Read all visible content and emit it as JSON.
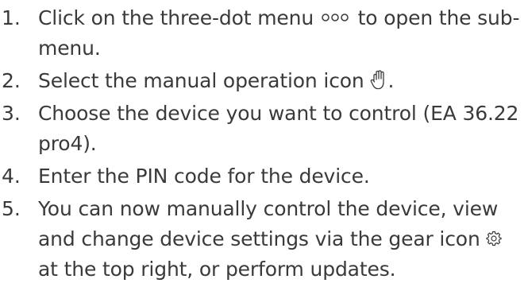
{
  "steps": [
    {
      "number": "1.",
      "before": "Click on the three-dot menu",
      "icon": "three-dot-menu-icon",
      "after": "to open the sub-menu."
    },
    {
      "number": "2.",
      "before": "Select the manual operation icon",
      "icon": "hand-icon",
      "after": "."
    },
    {
      "number": "3.",
      "before": "Choose the device you want to control (EA 36.22 pro4).",
      "icon": "",
      "after": ""
    },
    {
      "number": "4.",
      "before": "Enter the PIN code for the device.",
      "icon": "",
      "after": ""
    },
    {
      "number": "5.",
      "before": "You can now manually control the device, view and change device settings via the gear icon",
      "icon": "gear-icon",
      "after": "at the top right, or perform updates."
    }
  ]
}
